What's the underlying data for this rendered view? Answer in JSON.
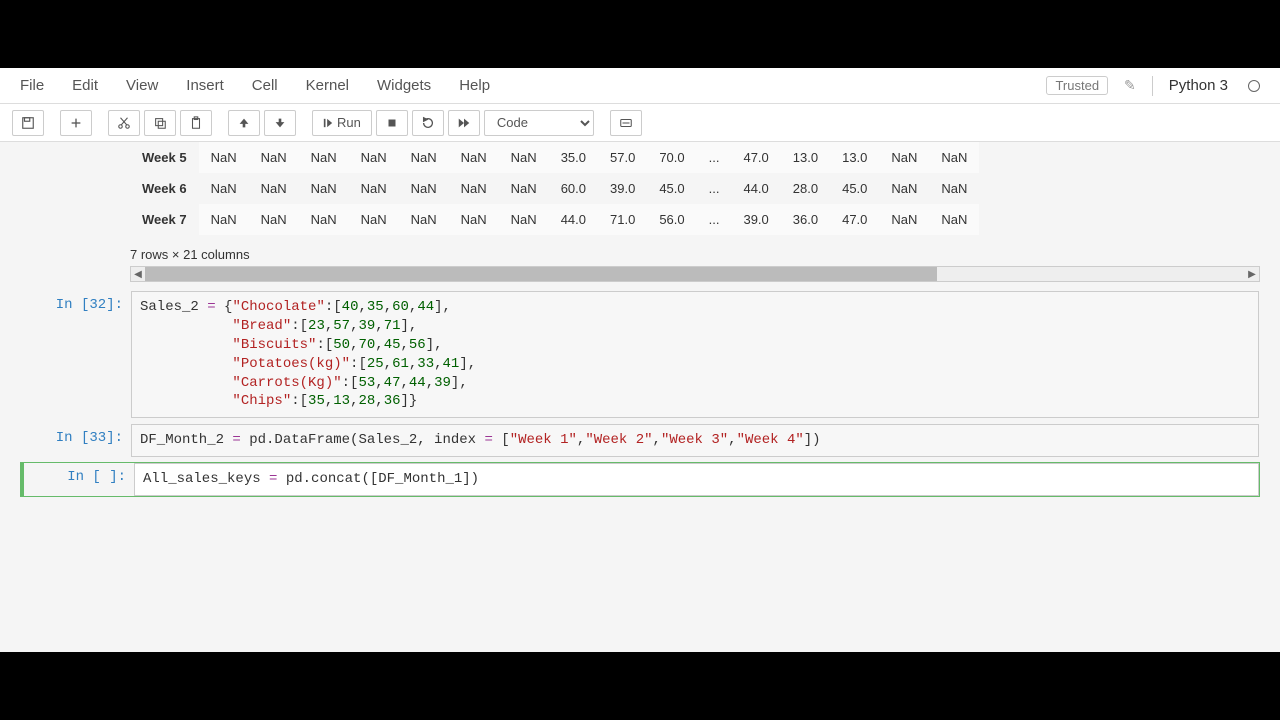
{
  "menubar": {
    "file": "File",
    "edit": "Edit",
    "view": "View",
    "insert": "Insert",
    "cell": "Cell",
    "kernel": "Kernel",
    "widgets": "Widgets",
    "help": "Help",
    "trusted": "Trusted",
    "kernel_name": "Python 3"
  },
  "toolbar": {
    "run": "Run",
    "celltype": "Code"
  },
  "table": {
    "rows": [
      {
        "name": "Week 5",
        "vals": [
          "NaN",
          "NaN",
          "NaN",
          "NaN",
          "NaN",
          "NaN",
          "NaN",
          "35.0",
          "57.0",
          "70.0",
          "...",
          "47.0",
          "13.0",
          "13.0",
          "NaN",
          "NaN"
        ]
      },
      {
        "name": "Week 6",
        "vals": [
          "NaN",
          "NaN",
          "NaN",
          "NaN",
          "NaN",
          "NaN",
          "NaN",
          "60.0",
          "39.0",
          "45.0",
          "...",
          "44.0",
          "28.0",
          "45.0",
          "NaN",
          "NaN"
        ]
      },
      {
        "name": "Week 7",
        "vals": [
          "NaN",
          "NaN",
          "NaN",
          "NaN",
          "NaN",
          "NaN",
          "NaN",
          "44.0",
          "71.0",
          "56.0",
          "...",
          "39.0",
          "36.0",
          "47.0",
          "NaN",
          "NaN"
        ]
      }
    ],
    "shape": "7 rows × 21 columns"
  },
  "cells": {
    "c32_prompt": "In [32]:",
    "c32_code_tokens": [
      [
        "punc",
        "Sales_2 "
      ],
      [
        "op",
        "="
      ],
      [
        "punc",
        " {"
      ],
      [
        "str",
        "\"Chocolate\""
      ],
      [
        "punc",
        ":["
      ],
      [
        "num",
        "40"
      ],
      [
        "punc",
        ","
      ],
      [
        "num",
        "35"
      ],
      [
        "punc",
        ","
      ],
      [
        "num",
        "60"
      ],
      [
        "punc",
        ","
      ],
      [
        "num",
        "44"
      ],
      [
        "punc",
        "],"
      ],
      [
        "nl",
        ""
      ],
      [
        "punc",
        "           "
      ],
      [
        "str",
        "\"Bread\""
      ],
      [
        "punc",
        ":["
      ],
      [
        "num",
        "23"
      ],
      [
        "punc",
        ","
      ],
      [
        "num",
        "57"
      ],
      [
        "punc",
        ","
      ],
      [
        "num",
        "39"
      ],
      [
        "punc",
        ","
      ],
      [
        "num",
        "71"
      ],
      [
        "punc",
        "],"
      ],
      [
        "nl",
        ""
      ],
      [
        "punc",
        "           "
      ],
      [
        "str",
        "\"Biscuits\""
      ],
      [
        "punc",
        ":["
      ],
      [
        "num",
        "50"
      ],
      [
        "punc",
        ","
      ],
      [
        "num",
        "70"
      ],
      [
        "punc",
        ","
      ],
      [
        "num",
        "45"
      ],
      [
        "punc",
        ","
      ],
      [
        "num",
        "56"
      ],
      [
        "punc",
        "],"
      ],
      [
        "nl",
        ""
      ],
      [
        "punc",
        "           "
      ],
      [
        "str",
        "\"Potatoes(kg)\""
      ],
      [
        "punc",
        ":["
      ],
      [
        "num",
        "25"
      ],
      [
        "punc",
        ","
      ],
      [
        "num",
        "61"
      ],
      [
        "punc",
        ","
      ],
      [
        "num",
        "33"
      ],
      [
        "punc",
        ","
      ],
      [
        "num",
        "41"
      ],
      [
        "punc",
        "],"
      ],
      [
        "nl",
        ""
      ],
      [
        "punc",
        "           "
      ],
      [
        "str",
        "\"Carrots(Kg)\""
      ],
      [
        "punc",
        ":["
      ],
      [
        "num",
        "53"
      ],
      [
        "punc",
        ","
      ],
      [
        "num",
        "47"
      ],
      [
        "punc",
        ","
      ],
      [
        "num",
        "44"
      ],
      [
        "punc",
        ","
      ],
      [
        "num",
        "39"
      ],
      [
        "punc",
        "],"
      ],
      [
        "nl",
        ""
      ],
      [
        "punc",
        "           "
      ],
      [
        "str",
        "\"Chips\""
      ],
      [
        "punc",
        ":["
      ],
      [
        "num",
        "35"
      ],
      [
        "punc",
        ","
      ],
      [
        "num",
        "13"
      ],
      [
        "punc",
        ","
      ],
      [
        "num",
        "28"
      ],
      [
        "punc",
        ","
      ],
      [
        "num",
        "36"
      ],
      [
        "punc",
        "]}"
      ]
    ],
    "c33_prompt": "In [33]:",
    "c33_code_tokens": [
      [
        "punc",
        "DF_Month_2 "
      ],
      [
        "op",
        "="
      ],
      [
        "punc",
        " pd.DataFrame(Sales_2, index "
      ],
      [
        "op",
        "="
      ],
      [
        "punc",
        " ["
      ],
      [
        "str",
        "\"Week 1\""
      ],
      [
        "punc",
        ","
      ],
      [
        "str",
        "\"Week 2\""
      ],
      [
        "punc",
        ","
      ],
      [
        "str",
        "\"Week 3\""
      ],
      [
        "punc",
        ","
      ],
      [
        "str",
        "\"Week 4\""
      ],
      [
        "punc",
        "])"
      ]
    ],
    "c_empty_prompt": "In [ ]:",
    "c_empty_code_tokens": [
      [
        "punc",
        "All_sales_keys "
      ],
      [
        "op",
        "="
      ],
      [
        "punc",
        " pd.concat([DF_Month_1])"
      ]
    ]
  }
}
